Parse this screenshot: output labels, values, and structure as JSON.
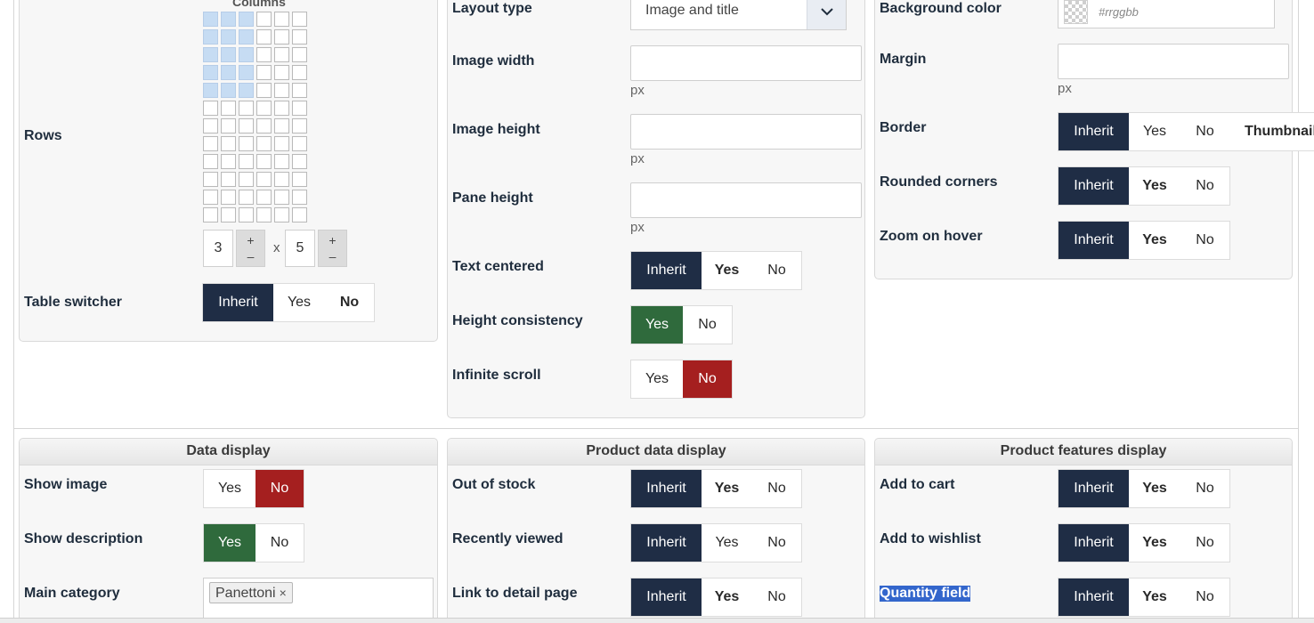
{
  "layout": {
    "columns_label": "Columns",
    "rows_label": "Rows",
    "rows_value": "3",
    "columns_value": "5",
    "times_sign": "x",
    "plus": "+",
    "minus": "–",
    "grid_total_rows": 12,
    "grid_total_cols": 6,
    "grid_selected_rows": 5,
    "grid_selected_cols": 3,
    "table_switcher": {
      "label": "Table switcher",
      "options": [
        "Inherit",
        "Yes",
        "No"
      ],
      "selected": "Inherit"
    }
  },
  "display": {
    "layout_type": {
      "label": "Layout type",
      "value": "Image and title"
    },
    "image_width": {
      "label": "Image width",
      "unit": "px",
      "value": ""
    },
    "image_height": {
      "label": "Image height",
      "unit": "px",
      "value": ""
    },
    "pane_height": {
      "label": "Pane height",
      "unit": "px",
      "value": ""
    },
    "text_centered": {
      "label": "Text centered",
      "options": [
        "Inherit",
        "Yes",
        "No"
      ],
      "selected": "Inherit"
    },
    "height_consistency": {
      "label": "Height consistency",
      "options": [
        "Yes",
        "No"
      ],
      "selected": "Yes"
    },
    "infinite_scroll": {
      "label": "Infinite scroll",
      "options": [
        "Yes",
        "No"
      ],
      "selected": "No"
    }
  },
  "style": {
    "background_color": {
      "label": "Background color",
      "placeholder": "#rrggbb"
    },
    "margin": {
      "label": "Margin",
      "unit": "px",
      "value": ""
    },
    "border": {
      "label": "Border",
      "options": [
        "Inherit",
        "Yes",
        "No",
        "Thumbnail"
      ],
      "selected": "Inherit"
    },
    "rounded_corners": {
      "label": "Rounded corners",
      "options": [
        "Inherit",
        "Yes",
        "No"
      ],
      "selected": "Inherit"
    },
    "zoom_on_hover": {
      "label": "Zoom on hover",
      "options": [
        "Inherit",
        "Yes",
        "No"
      ],
      "selected": "Inherit"
    }
  },
  "data_display": {
    "title": "Data display",
    "show_image": {
      "label": "Show image",
      "options": [
        "Yes",
        "No"
      ],
      "selected": "No"
    },
    "show_description": {
      "label": "Show description",
      "options": [
        "Yes",
        "No"
      ],
      "selected": "Yes"
    },
    "main_category": {
      "label": "Main category",
      "tags": [
        "Panettoni"
      ],
      "remove": "×"
    }
  },
  "product_data_display": {
    "title": "Product data display",
    "out_of_stock": {
      "label": "Out of stock",
      "options": [
        "Inherit",
        "Yes",
        "No"
      ],
      "selected": "Inherit"
    },
    "recently_viewed": {
      "label": "Recently viewed",
      "options": [
        "Inherit",
        "Yes",
        "No"
      ],
      "selected": "Inherit"
    },
    "link_to_detail_page": {
      "label": "Link to detail page",
      "options": [
        "Inherit",
        "Yes",
        "No"
      ],
      "selected": "Inherit"
    }
  },
  "product_features_display": {
    "title": "Product features display",
    "add_to_cart": {
      "label": "Add to cart",
      "options": [
        "Inherit",
        "Yes",
        "No"
      ],
      "selected": "Inherit"
    },
    "add_to_wishlist": {
      "label": "Add to wishlist",
      "options": [
        "Inherit",
        "Yes",
        "No"
      ],
      "selected": "Inherit"
    },
    "quantity_field": {
      "label": "Quantity field",
      "options": [
        "Inherit",
        "Yes",
        "No"
      ],
      "selected": "Inherit"
    }
  },
  "colors": {
    "inherit_active": "#1f2d45",
    "yes_active": "#2f6a3c",
    "no_active": "#a51f1f",
    "selection_highlight": "#3366cc"
  }
}
